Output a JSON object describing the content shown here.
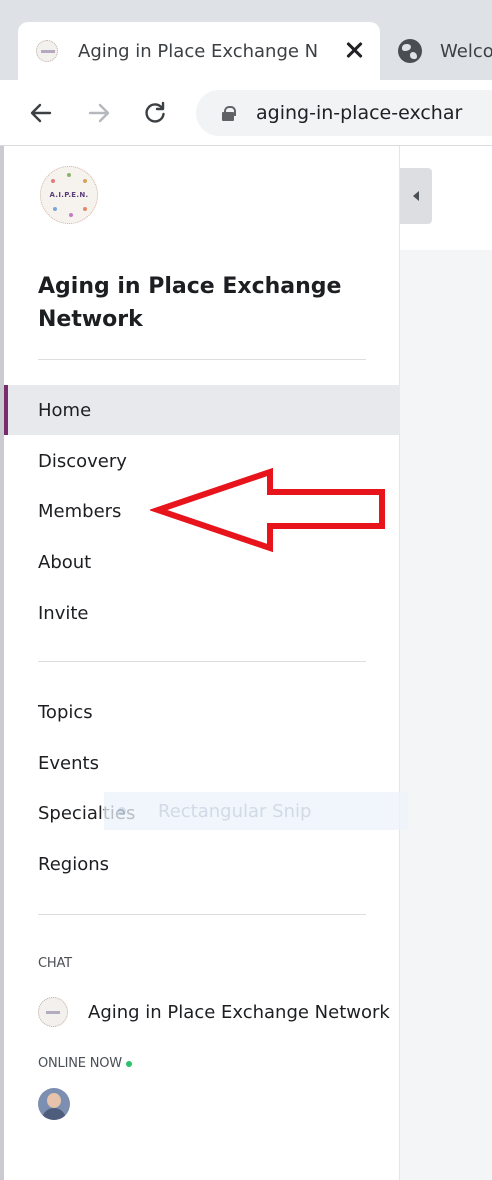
{
  "browser": {
    "active_tab_title": "Aging in Place Exchange N",
    "inactive_tab_title": "Welco",
    "url": "aging-in-place-exchar"
  },
  "sidebar": {
    "logo_text": "A.I.P.E.N.",
    "network_title": "Aging in Place Exchange Network",
    "primary_nav": [
      "Home",
      "Discovery",
      "Members",
      "About",
      "Invite"
    ],
    "active_item": "Home",
    "secondary_nav": [
      "Topics",
      "Events",
      "Specialties",
      "Regions"
    ],
    "chat_label": "CHAT",
    "chat_item": "Aging in Place Exchange Network",
    "online_label": "ONLINE NOW"
  },
  "overlay": {
    "snip_text": "Rectangular Snip"
  },
  "colors": {
    "active_accent": "#7a2b6e",
    "annotation_arrow": "#e8141c",
    "online_dot": "#2bc26b"
  }
}
